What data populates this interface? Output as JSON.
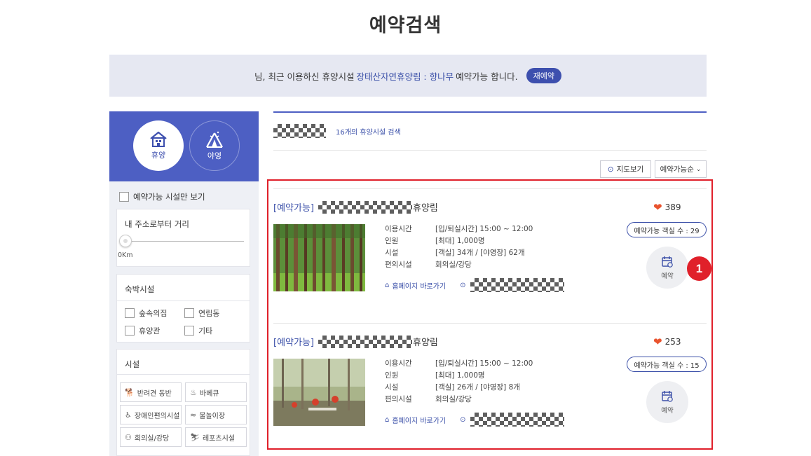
{
  "page": {
    "title": "예약검색"
  },
  "banner": {
    "prefix": "님, 최근 이용하신 휴양시설",
    "facility": "장태산자연휴양림 : 향나무",
    "suffix": "예약가능 합니다.",
    "rebook_label": "재예약"
  },
  "sidebar": {
    "modes": [
      {
        "label": "휴양",
        "icon": "house-icon",
        "active": true
      },
      {
        "label": "야영",
        "icon": "tent-icon",
        "active": false
      }
    ],
    "only_available_label": "예약가능 시설만 보기",
    "distance": {
      "title": "내 주소로부터 거리",
      "value": "0Km"
    },
    "lodging": {
      "title": "숙박시설",
      "options": [
        "숲속의집",
        "연립동",
        "휴양관",
        "기타"
      ]
    },
    "facilities": {
      "title": "시설",
      "options": [
        {
          "label": "반려견 동반",
          "icon": "dog-icon"
        },
        {
          "label": "바베큐",
          "icon": "grill-icon"
        },
        {
          "label": "장애인편의시설",
          "icon": "wheelchair-icon"
        },
        {
          "label": "물놀이장",
          "icon": "water-icon"
        },
        {
          "label": "회의실/강당",
          "icon": "meeting-icon"
        },
        {
          "label": "레포츠시설",
          "icon": "sports-icon"
        }
      ]
    }
  },
  "results": {
    "count_text": "16개의 휴양시설 검색",
    "map_label": "지도보기",
    "sort_label": "예약가능순",
    "items": [
      {
        "status": "[예약가능]",
        "name_suffix": "휴양림",
        "likes": "389",
        "available_rooms": "예약가능 객실 수 : 29",
        "info": [
          {
            "key": "이용시간",
            "value": "[입/퇴실시간] 15:00 ~ 12:00"
          },
          {
            "key": "인원",
            "value": "[최대] 1,000명"
          },
          {
            "key": "시설",
            "value": "[객실] 34개 / [야영장] 62개"
          },
          {
            "key": "편의시설",
            "value": "회의실/강당"
          }
        ],
        "homepage_label": "홈페이지 바로가기",
        "book_label": "예약"
      },
      {
        "status": "[예약가능]",
        "name_suffix": "휴양림",
        "likes": "253",
        "available_rooms": "예약가능 객실 수 : 15",
        "info": [
          {
            "key": "이용시간",
            "value": "[입/퇴실시간] 15:00 ~ 12:00"
          },
          {
            "key": "인원",
            "value": "[최대] 1,000명"
          },
          {
            "key": "시설",
            "value": "[객실] 26개 / [야영장] 8개"
          },
          {
            "key": "편의시설",
            "value": "회의실/강당"
          }
        ],
        "homepage_label": "홈페이지 바로가기",
        "book_label": "예약"
      }
    ]
  },
  "annotation": {
    "marker": "1"
  },
  "colors": {
    "accent": "#4d5fc3",
    "link": "#3a4fa8",
    "highlight": "#e0202a",
    "heart": "#e9532e"
  }
}
